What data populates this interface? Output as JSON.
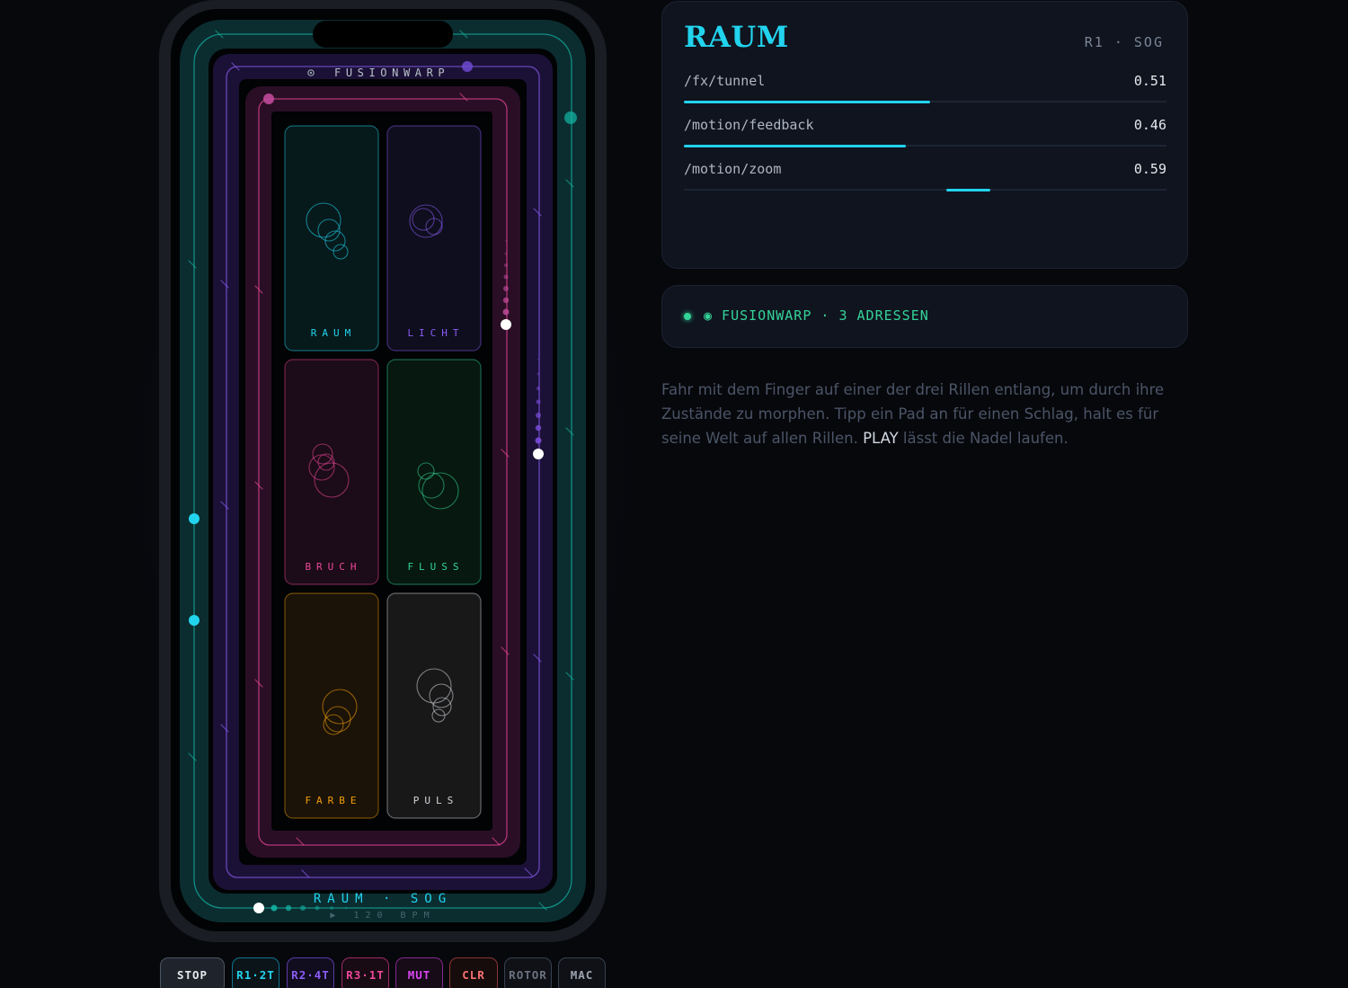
{
  "device": {
    "app_name": "FUSIONWARP",
    "world_label": "RAUM · SOG",
    "tempo_label": "▶ 120 BPM",
    "pads": [
      {
        "name": "RAUM",
        "color": "#22d3ee",
        "bg": "#061a1c"
      },
      {
        "name": "LICHT",
        "color": "#8b5cf6",
        "bg": "#0f0e1e"
      },
      {
        "name": "BRUCH",
        "color": "#ec4899",
        "bg": "#1c0b18"
      },
      {
        "name": "FLUSS",
        "color": "#34d399",
        "bg": "#06180f"
      },
      {
        "name": "FARBE",
        "color": "#f59e0b",
        "bg": "#1b1307"
      },
      {
        "name": "PULS",
        "color": "#d1d5db",
        "bg": "#181818"
      }
    ],
    "colors": {
      "outer_ring": "#14b8a6",
      "middle_ring": "#8b5cf6",
      "inner_ring": "#ec4899",
      "accent": "#22d3ee"
    }
  },
  "panel": {
    "title": "RAUM",
    "code": "R1 · SOG",
    "params": [
      {
        "address": "/fx/tunnel",
        "value": "0.51",
        "level": 0.51,
        "mode": "fill"
      },
      {
        "address": "/motion/feedback",
        "value": "0.46",
        "level": 0.46,
        "mode": "fill"
      },
      {
        "address": "/motion/zoom",
        "value": "0.59",
        "level": 0.59,
        "mode": "marker"
      }
    ]
  },
  "status": {
    "text": "◉ FUSIONWARP · 3 ADRESSEN",
    "color": "#34d399"
  },
  "help": {
    "part1": "Fahr mit dem Finger auf einer der drei Rillen entlang, um durch ihre Zustände zu morphen. Tipp ein Pad an für einen Schlag, halt es für seine Welt auf allen Rillen. ",
    "keyword": "PLAY",
    "part2": " lässt die Nadel laufen."
  },
  "buttons": [
    {
      "label": "STOP",
      "color": "#e5e7eb",
      "border": "#4b5563",
      "bg": "#1f242c"
    },
    {
      "label": "R1·2T",
      "color": "#22d3ee",
      "border": "#0e7490",
      "bg": "#0b1418"
    },
    {
      "label": "R2·4T",
      "color": "#8b5cf6",
      "border": "#5b3aa8",
      "bg": "#110d1e"
    },
    {
      "label": "R3·1T",
      "color": "#ec4899",
      "border": "#9d2a67",
      "bg": "#180b14"
    },
    {
      "label": "MUT",
      "color": "#d946ef",
      "border": "#86288f",
      "bg": "#160b17"
    },
    {
      "label": "CLR",
      "color": "#f87171",
      "border": "#8a3434",
      "bg": "#170c0c"
    },
    {
      "label": "ROTOR",
      "color": "#6b7280",
      "border": "#374151",
      "bg": "#0f1116"
    },
    {
      "label": "MAC",
      "color": "#9ca3af",
      "border": "#374151",
      "bg": "#0f1116"
    }
  ]
}
